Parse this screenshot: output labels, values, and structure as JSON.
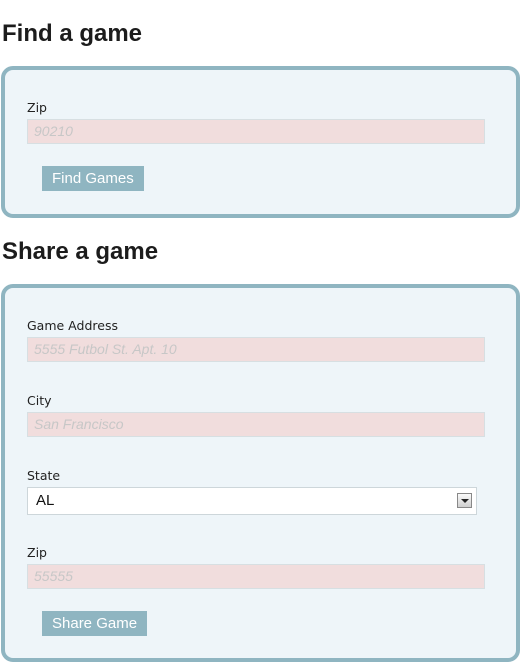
{
  "find": {
    "title": "Find a game",
    "zip_label": "Zip",
    "zip_placeholder": "90210",
    "button_label": "Find Games"
  },
  "share": {
    "title": "Share a game",
    "address_label": "Game Address",
    "address_placeholder": "5555 Futbol St. Apt. 10",
    "city_label": "City",
    "city_placeholder": "San Francisco",
    "state_label": "State",
    "state_value": "AL",
    "zip_label": "Zip",
    "zip_placeholder": "55555",
    "button_label": "Share Game"
  },
  "colors": {
    "panel_border": "#8fb5c1",
    "panel_bg": "#eef5f9",
    "field_bg": "#f1dddd",
    "button_bg": "#8fb5c1"
  }
}
